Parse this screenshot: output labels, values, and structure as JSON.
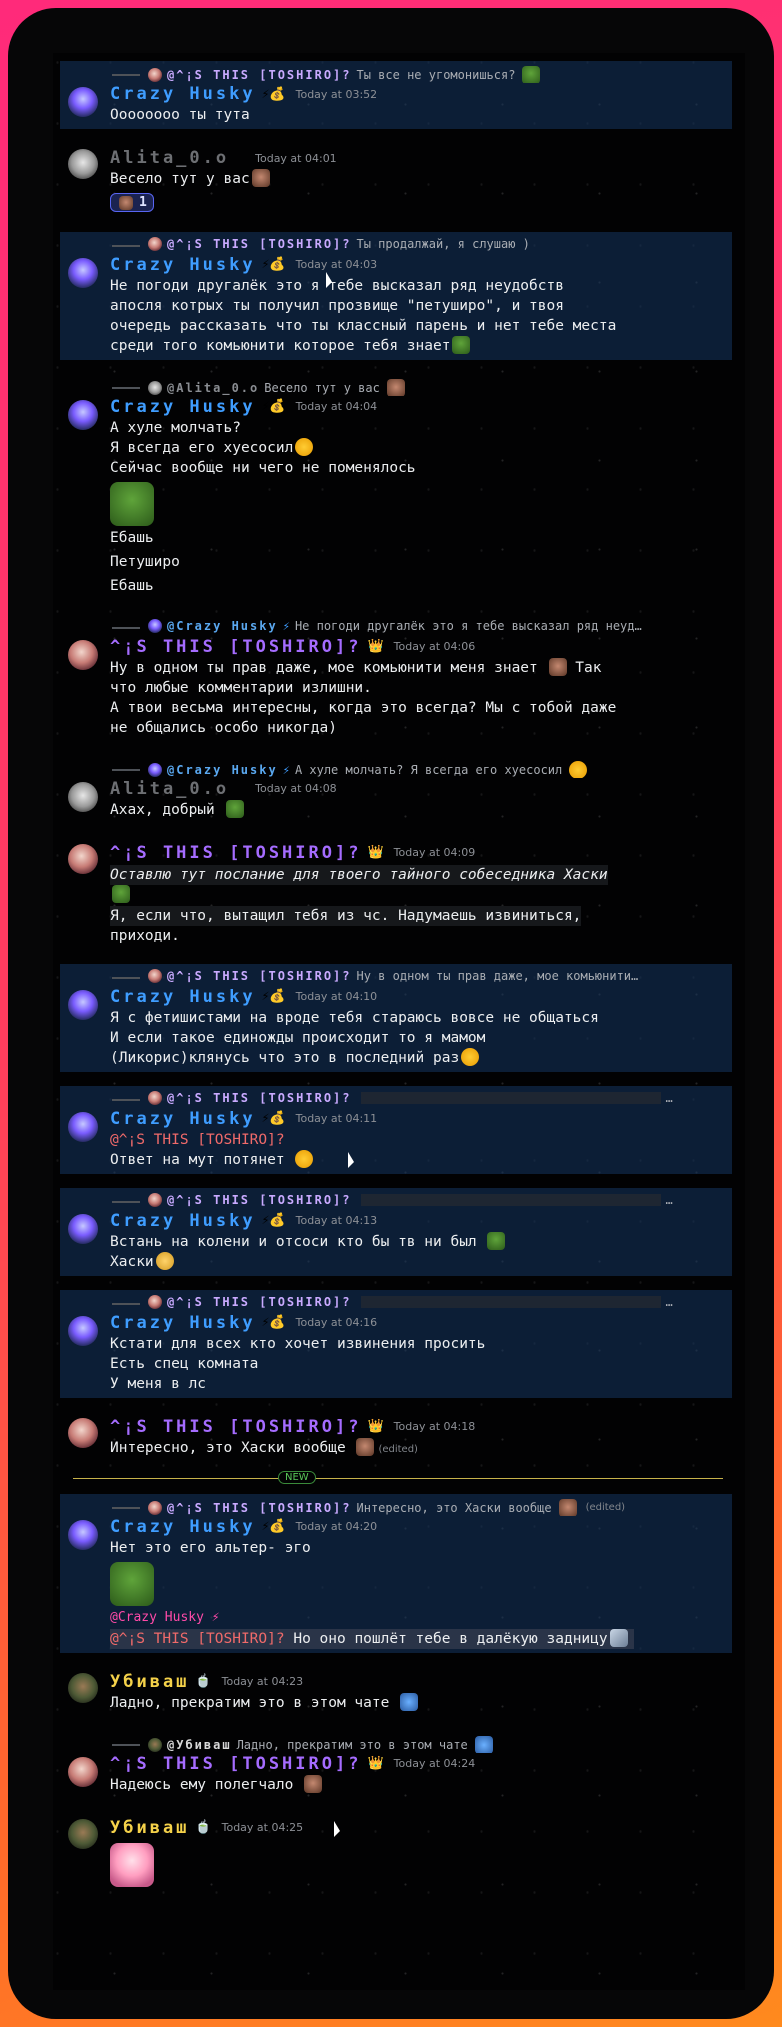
{
  "users": {
    "husky": "Crazy Husky",
    "tosh": "^¡S THIS [TOSHIRO]?",
    "alita": "Alita_0.o",
    "uby": "Убиваш"
  },
  "reply_names": {
    "tosh": "@^¡S THIS [TOSHIRO]?",
    "alita": "@Alita_0.o",
    "husky": "@Crazy Husky",
    "uby": "@Убиваш"
  },
  "badges": {
    "husky": "⚡💰",
    "tosh": "👑",
    "uby": "🍵"
  },
  "messages": {
    "m1": {
      "reply_text": "Ты все не угомонишься?",
      "time": "Today at 03:52",
      "l1": "Оооооооо ты тута"
    },
    "m2": {
      "time": "Today at 04:01",
      "l1": "Весело тут у вас",
      "reaction_count": "1"
    },
    "m3": {
      "reply_text": "Ты продалжай, я слушаю )",
      "time": "Today at 04:03",
      "l1": "Не погоди другалёк это я тебе высказал ряд неудобств",
      "l2": "апосля котрых ты получил прозвище \"петуширо\", и твоя",
      "l3": "очередь рассказать что ты классный парень и нет тебе места",
      "l4": "среди того комьюнити которое тебя знает"
    },
    "m4": {
      "reply_text": "Весело тут у вас",
      "time": "Today at 04:04",
      "l1": "А хуле молчать?",
      "l2": "Я всегда его хуесосил",
      "l3": "Сейчас вообще ни чего не поменялось",
      "l4": "Ебашь",
      "l5": "Петуширо",
      "l6": "Ебашь"
    },
    "m5": {
      "reply_text": "Не погоди другалёк это я тебе высказал ряд неуд…",
      "time": "Today at 04:06",
      "l1": "Ну в одном ты прав даже, мое комьюнити меня знает",
      "l1b": "Так",
      "l2": "что любые комментарии излишни.",
      "l3": "А твои весьма интересны, когда это всегда? Мы с тобой даже",
      "l4": "не общались особо никогда)"
    },
    "m6": {
      "reply_text": "А хуле молчать? Я всегда его хуесосил",
      "time": "Today at 04:08",
      "l1": "Ахах, добрый"
    },
    "m7": {
      "time": "Today at 04:09",
      "l1": "Оставлю тут послание для твоего тайного собеседника Хаски",
      "l2": "Я, если что, вытащил тебя из чс. Надумаешь извиниться,",
      "l3": "приходи."
    },
    "m8": {
      "reply_text": "Ну в одном ты прав даже, мое комьюнити…",
      "time": "Today at 04:10",
      "l1": "Я с фетишистами на вроде тебя стараюсь вовсе не общаться",
      "l2": "И если такое единожды происходит то я мамом",
      "l3": "(Ликорис)клянусь что это в последний раз"
    },
    "m9": {
      "time": "Today at 04:11",
      "mention": "@^¡S THIS [TOSHIRO]?",
      "l1": "Ответ на мут потянет"
    },
    "m10": {
      "time": "Today at 04:13",
      "l1": "Встань на колени и отсоси кто бы тв ни был",
      "l2": "Хаски"
    },
    "m11": {
      "time": "Today at 04:16",
      "l1": "Кстати для всех кто хочет извинения просить",
      "l2": "Есть спец комната",
      "l3": "У меня в лс"
    },
    "m12": {
      "time": "Today at 04:18",
      "l1": "Интересно, это Хаски вообще",
      "edited": "(edited)"
    },
    "m13": {
      "reply_text": "Интересно, это Хаски вообще",
      "time": "Today at 04:20",
      "l1": "Нет это его альтер- эго",
      "mention_a": "@Crazy Husky",
      "mention_b": "@^¡S THIS [TOSHIRO]?",
      "l2": "Но оно пошлёт тебе в далёкую задницу"
    },
    "m14": {
      "time": "Today at 04:23",
      "l1": "Ладно, прекратим это в этом чате"
    },
    "m15": {
      "reply_text": "Ладно, прекратим это в этом чате",
      "time": "Today at 04:24",
      "l1": "Надеюсь ему полегчало"
    },
    "m16": {
      "time": "Today at 04:25"
    }
  },
  "ellipsis": "…",
  "edited_label": "(edited)",
  "new_divider": "NEW"
}
